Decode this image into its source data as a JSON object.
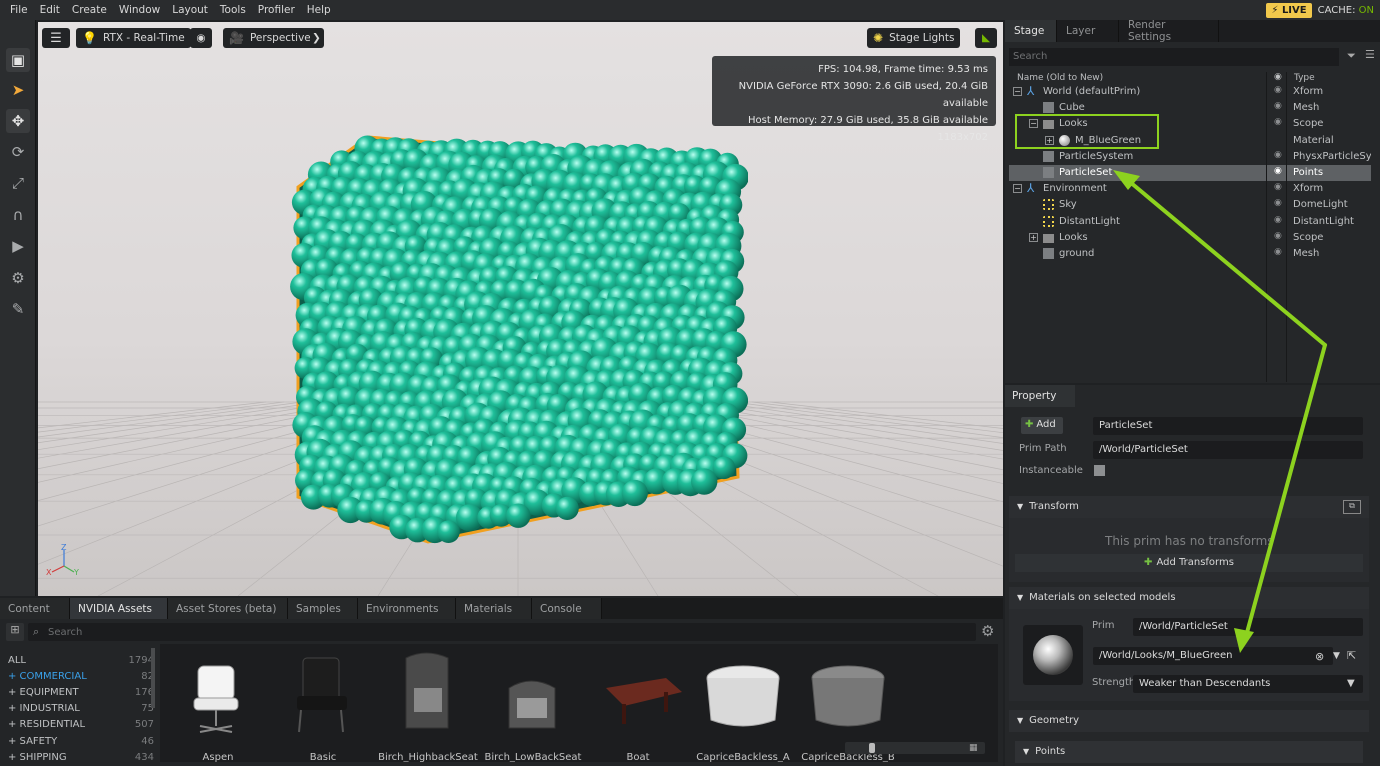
{
  "menubar": {
    "items": [
      "File",
      "Edit",
      "Create",
      "Window",
      "Layout",
      "Tools",
      "Profiler",
      "Help"
    ],
    "live_label": "LIVE",
    "cache_label": "CACHE:",
    "cache_state": "ON"
  },
  "viewport": {
    "renderer_label": "RTX - Real-Time",
    "camera_label": "Perspective",
    "lights_label": "Stage Lights",
    "stats": {
      "fps": "FPS: 104.98, Frame time: 9.53 ms",
      "gpu": "NVIDIA GeForce RTX 3090: 2.6 GiB used, 20.4 GiB available",
      "host": "Host Memory: 27.9 GiB used, 35.8 GiB available",
      "resolution": "1183x702"
    },
    "particle_color": "#1fbf9a",
    "selection_outline_color": "#f0a020",
    "axis": {
      "z": "Z",
      "x": "X",
      "y": "Y"
    }
  },
  "assets": {
    "tabs": [
      "Content",
      "NVIDIA Assets",
      "Asset Stores (beta)",
      "Samples",
      "Environments",
      "Materials",
      "Console"
    ],
    "active_tab": "NVIDIA Assets",
    "search_placeholder": "Search",
    "categories": [
      {
        "label": "ALL",
        "count": "1794"
      },
      {
        "label": "+ COMMERCIAL",
        "count": "82"
      },
      {
        "label": "+ EQUIPMENT",
        "count": "176"
      },
      {
        "label": "+ INDUSTRIAL",
        "count": "75"
      },
      {
        "label": "+ RESIDENTIAL",
        "count": "507"
      },
      {
        "label": "+ SAFETY",
        "count": "46"
      },
      {
        "label": "+ SHIPPING",
        "count": "434"
      }
    ],
    "items": [
      "Aspen",
      "Basic",
      "Birch_HighbackSeat",
      "Birch_LowBackSeat",
      "Boat",
      "CapriceBackless_A",
      "CapriceBackless_B"
    ]
  },
  "stage": {
    "tabs": [
      "Stage",
      "Layer",
      "Render Settings"
    ],
    "search_placeholder": "Search",
    "col_name": "Name (Old to New)",
    "col_type": "Type",
    "rows": [
      {
        "name": "World (defaultPrim)",
        "type": "Xform"
      },
      {
        "name": "Cube",
        "type": "Mesh"
      },
      {
        "name": "Looks",
        "type": "Scope"
      },
      {
        "name": "M_BlueGreen",
        "type": "Material"
      },
      {
        "name": "ParticleSystem",
        "type": "PhysxParticleSystem"
      },
      {
        "name": "ParticleSet",
        "type": "Points"
      },
      {
        "name": "Environment",
        "type": "Xform"
      },
      {
        "name": "Sky",
        "type": "DomeLight"
      },
      {
        "name": "DistantLight",
        "type": "DistantLight"
      },
      {
        "name": "Looks",
        "type": "Scope"
      },
      {
        "name": "ground",
        "type": "Mesh"
      }
    ]
  },
  "property": {
    "tab": "Property",
    "add_label": "Add",
    "prim_name": "ParticleSet",
    "prim_path_label": "Prim Path",
    "prim_path": "/World/ParticleSet",
    "instanceable_label": "Instanceable",
    "transform_header": "Transform",
    "no_transforms": "This prim has no transforms",
    "add_transforms": "Add Transforms",
    "materials_header": "Materials on selected models",
    "mat_prim_label": "Prim",
    "mat_prim_value": "/World/ParticleSet",
    "mat_path": "/World/Looks/M_BlueGreen",
    "strength_label": "Strength",
    "strength_value": "Weaker than Descendants",
    "geometry_header": "Geometry",
    "points_header": "Points"
  },
  "colors": {
    "accent_green": "#76b900",
    "annotation_green": "#8dd21f",
    "live_yellow": "#f2c94c",
    "selected_category": "#3aa0e8"
  }
}
